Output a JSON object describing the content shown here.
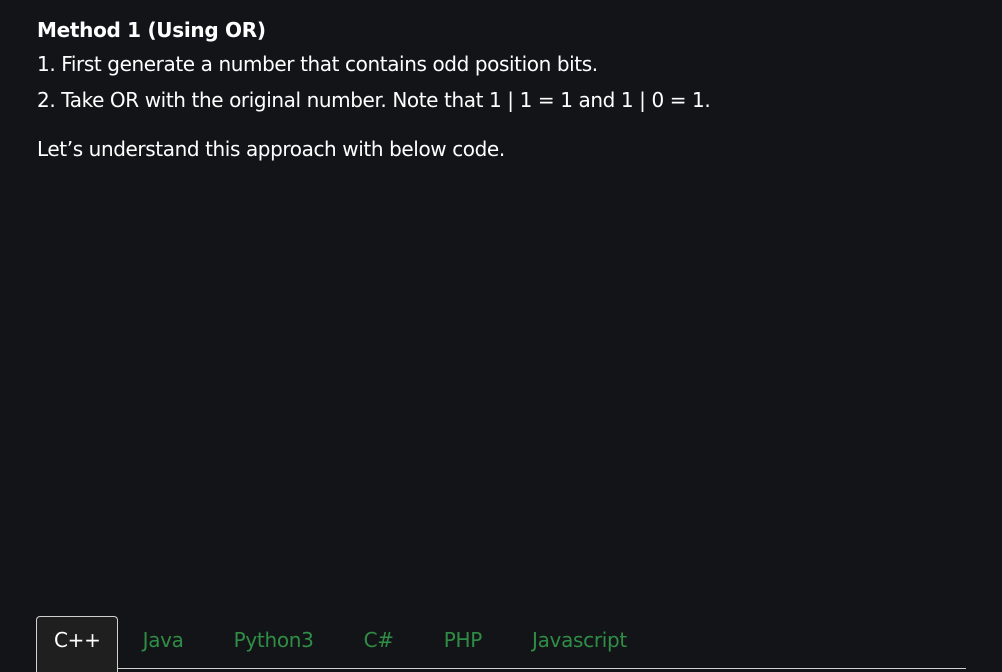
{
  "article": {
    "heading": "Method 1 (Using OR)",
    "steps": [
      "1. First generate a number that contains odd position bits.",
      "2. Take OR with the original number. Note that 1 | 1 = 1 and 1 | 0 = 1."
    ],
    "intro": "Let’s understand this approach with below code."
  },
  "code_tabs": {
    "active": "C++",
    "items": [
      "C++",
      "Java",
      "Python3",
      "C#",
      "PHP",
      "Javascript"
    ]
  },
  "colors": {
    "background": "#131417",
    "text": "#ffffff",
    "tab_link": "#2f8d46",
    "active_tab_bg": "#1f1f1f",
    "tab_border": "#d0d0d0"
  }
}
